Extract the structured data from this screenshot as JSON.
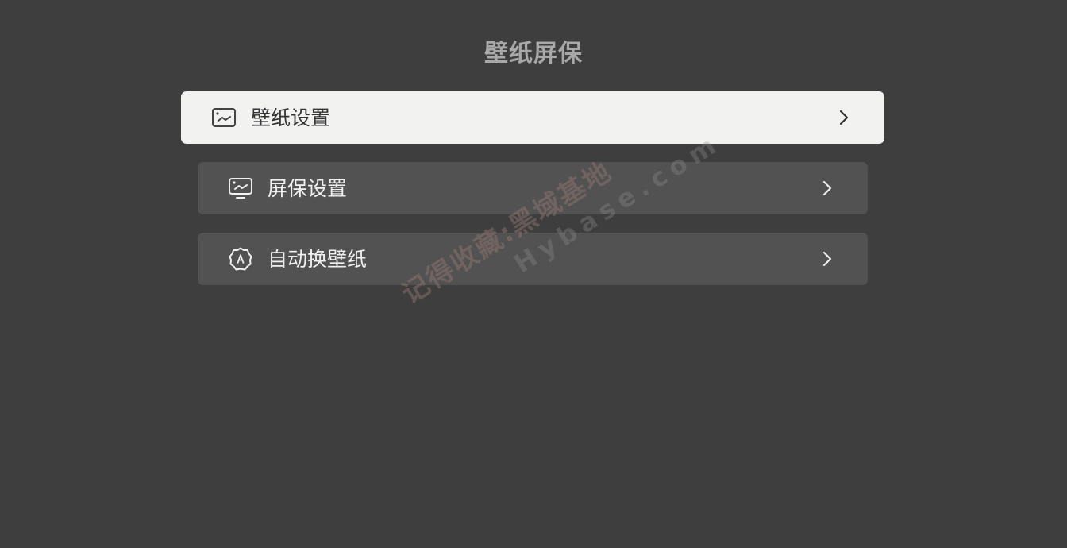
{
  "page": {
    "title": "壁纸屏保"
  },
  "menu": {
    "items": [
      {
        "label": "壁纸设置",
        "icon": "image-icon",
        "selected": true
      },
      {
        "label": "屏保设置",
        "icon": "monitor-image-icon",
        "selected": false
      },
      {
        "label": "自动换壁纸",
        "icon": "auto-badge-icon",
        "selected": false
      }
    ]
  },
  "watermark": {
    "line1": "记得收藏:黑域基地",
    "line2": "Hybase.com"
  },
  "colors": {
    "background": "#3e3e3e",
    "item_bg": "#525252",
    "item_selected_bg": "#f2f2f0",
    "title": "#a8a8a8"
  }
}
